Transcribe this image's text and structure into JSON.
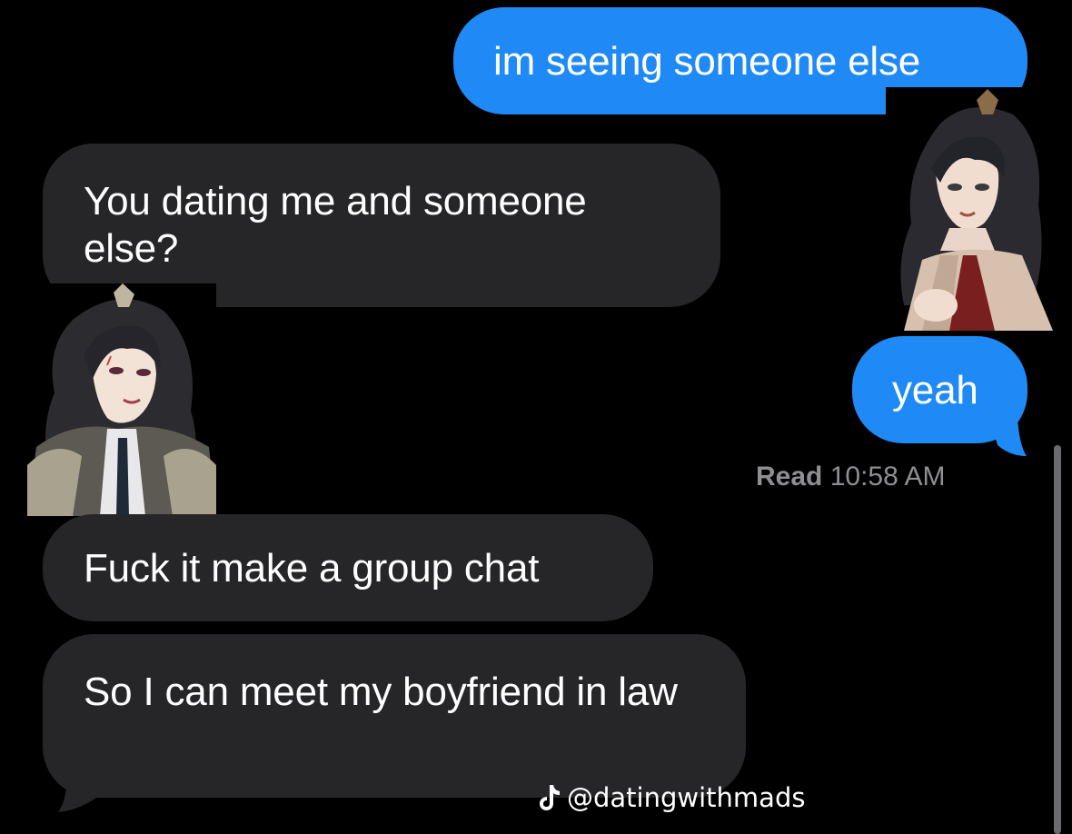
{
  "messages": [
    {
      "direction": "sent",
      "text": "im seeing someone else"
    },
    {
      "direction": "received",
      "text": "You dating me and someone else?"
    },
    {
      "direction": "sent",
      "text": "yeah"
    },
    {
      "direction": "received",
      "text": "Fuck it make a group chat"
    },
    {
      "direction": "received",
      "text": "So I can meet my boyfriend in law"
    }
  ],
  "read_receipt": {
    "label": "Read",
    "time": "10:58 AM"
  },
  "watermark": {
    "icon": "tiktok-icon",
    "handle": "@datingwithmads"
  },
  "avatars": {
    "sender_sticker": "anime-character-illustration",
    "receiver_sticker": "anime-character-illustration"
  },
  "colors": {
    "sent_bubble": "#1f8af5",
    "received_bubble": "#262628",
    "background": "#000000",
    "read_receipt_text": "#8e8e93"
  }
}
